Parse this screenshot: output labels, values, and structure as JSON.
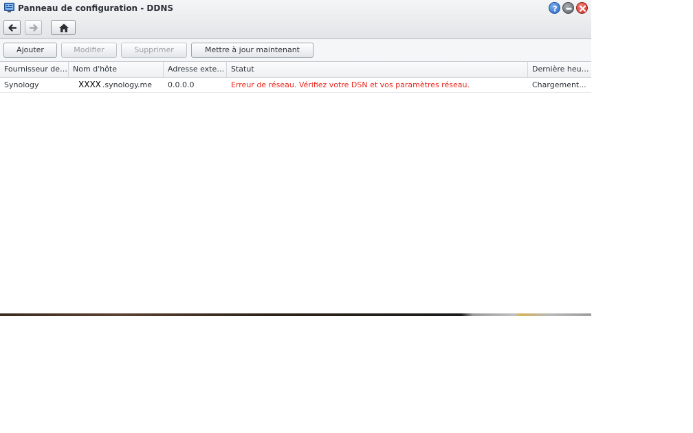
{
  "window": {
    "title": "Panneau de configuration - DDNS",
    "icon": "control-panel-icon",
    "controls": [
      "help-icon",
      "minimize-icon",
      "close-icon"
    ]
  },
  "nav": {
    "back": "back-arrow-icon",
    "forward": "forward-arrow-icon",
    "home": "home-icon"
  },
  "toolbar": {
    "add_label": "Ajouter",
    "modify_label": "Modifier",
    "delete_label": "Supprimer",
    "update_label": "Mettre à jour maintenant"
  },
  "table": {
    "columns": [
      "Fournisseur de service",
      "Nom d'hôte",
      "Adresse externe",
      "Statut",
      "Dernière heure de mise à jour"
    ],
    "rows": [
      {
        "provider": "Synology",
        "hostname_redacted": "XXXX",
        "hostname_suffix": ".synology.me",
        "address": "0.0.0.0",
        "status": "Erreur de réseau. Vérifiez votre DSN et vos paramètres réseau.",
        "last_update": "Chargement..."
      }
    ]
  },
  "colors": {
    "error": "#e8251a",
    "text": "#2d3238"
  }
}
